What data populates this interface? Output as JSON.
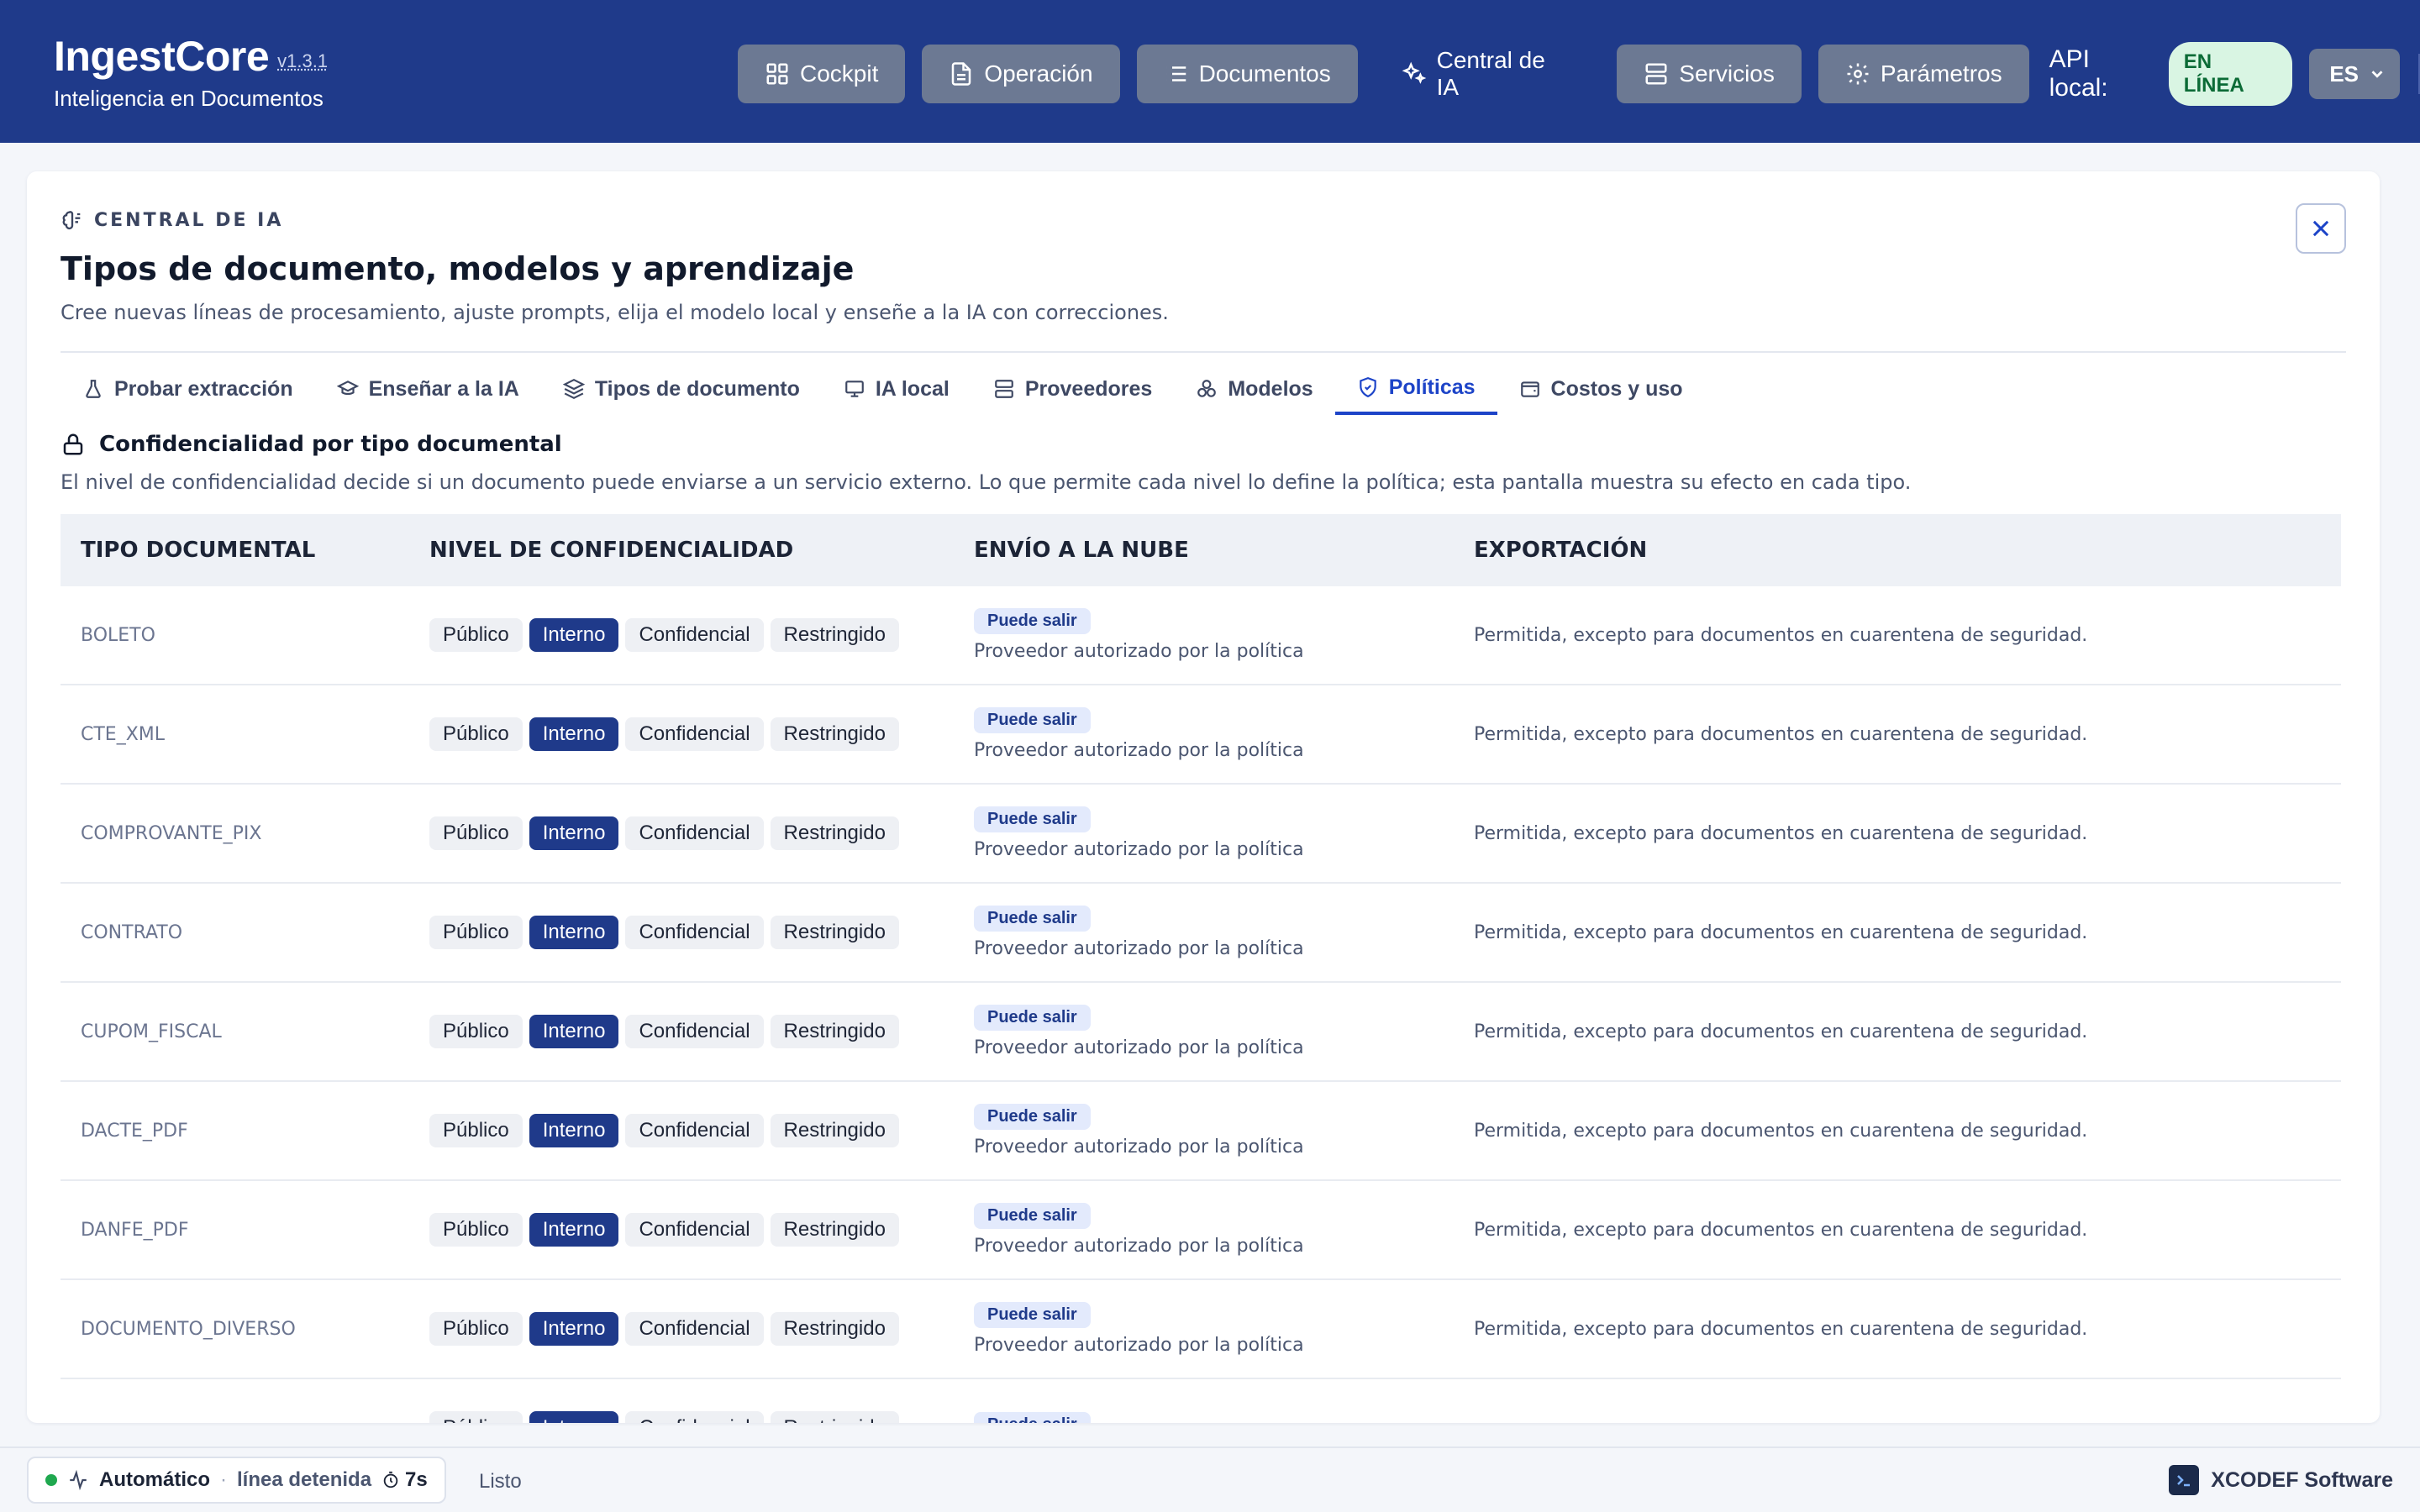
{
  "app": {
    "name": "IngestCore",
    "version": "v1.3.1",
    "subtitle": "Inteligencia en Documentos"
  },
  "nav": {
    "items": [
      {
        "label": "Cockpit",
        "icon": "grid-icon"
      },
      {
        "label": "Operación",
        "icon": "document-icon"
      },
      {
        "label": "Documentos",
        "icon": "list-icon"
      },
      {
        "label": "Central de IA",
        "icon": "sparkles-icon"
      },
      {
        "label": "Servicios",
        "icon": "server-icon"
      },
      {
        "label": "Parámetros",
        "icon": "gear-icon"
      }
    ],
    "api_label": "API local:",
    "api_status": "EN LÍNEA",
    "language": "ES"
  },
  "panel": {
    "eyebrow": "CENTRAL DE IA",
    "title": "Tipos de documento, modelos y aprendizaje",
    "subtitle": "Cree nuevas líneas de procesamiento, ajuste prompts, elija el modelo local y enseñe a la IA con correcciones."
  },
  "tabs": [
    {
      "label": "Probar extracción",
      "icon": "flask-icon"
    },
    {
      "label": "Enseñar a la IA",
      "icon": "graduation-cap-icon"
    },
    {
      "label": "Tipos de documento",
      "icon": "layers-icon"
    },
    {
      "label": "IA local",
      "icon": "monitor-icon"
    },
    {
      "label": "Proveedores",
      "icon": "server-icon"
    },
    {
      "label": "Modelos",
      "icon": "boxes-icon"
    },
    {
      "label": "Políticas",
      "icon": "shield-icon",
      "active": true
    },
    {
      "label": "Costos y uso",
      "icon": "wallet-icon"
    }
  ],
  "section": {
    "title": "Confidencialidad por tipo documental",
    "description": "El nivel de confidencialidad decide si un documento puede enviarse a un servicio externo. Lo que permite cada nivel lo define la política; esta pantalla muestra su efecto en cada tipo."
  },
  "table": {
    "headers": [
      "TIPO DOCUMENTAL",
      "NIVEL DE CONFIDENCIALIDAD",
      "ENVÍO A LA NUBE",
      "EXPORTACIÓN"
    ],
    "levels": [
      "Público",
      "Interno",
      "Confidencial",
      "Restringido"
    ],
    "rows": [
      {
        "type": "BOLETO",
        "level": "Interno",
        "cloud_badge": "Puede salir",
        "cloud_note": "Proveedor autorizado por la política",
        "export": "Permitida, excepto para documentos en cuarentena de seguridad."
      },
      {
        "type": "CTE_XML",
        "level": "Interno",
        "cloud_badge": "Puede salir",
        "cloud_note": "Proveedor autorizado por la política",
        "export": "Permitida, excepto para documentos en cuarentena de seguridad."
      },
      {
        "type": "COMPROVANTE_PIX",
        "level": "Interno",
        "cloud_badge": "Puede salir",
        "cloud_note": "Proveedor autorizado por la política",
        "export": "Permitida, excepto para documentos en cuarentena de seguridad."
      },
      {
        "type": "CONTRATO",
        "level": "Interno",
        "cloud_badge": "Puede salir",
        "cloud_note": "Proveedor autorizado por la política",
        "export": "Permitida, excepto para documentos en cuarentena de seguridad."
      },
      {
        "type": "CUPOM_FISCAL",
        "level": "Interno",
        "cloud_badge": "Puede salir",
        "cloud_note": "Proveedor autorizado por la política",
        "export": "Permitida, excepto para documentos en cuarentena de seguridad."
      },
      {
        "type": "DACTE_PDF",
        "level": "Interno",
        "cloud_badge": "Puede salir",
        "cloud_note": "Proveedor autorizado por la política",
        "export": "Permitida, excepto para documentos en cuarentena de seguridad."
      },
      {
        "type": "DANFE_PDF",
        "level": "Interno",
        "cloud_badge": "Puede salir",
        "cloud_note": "Proveedor autorizado por la política",
        "export": "Permitida, excepto para documentos en cuarentena de seguridad."
      },
      {
        "type": "DOCUMENTO_DIVERSO",
        "level": "Interno",
        "cloud_badge": "Puede salir",
        "cloud_note": "Proveedor autorizado por la política",
        "export": "Permitida, excepto para documentos en cuarentena de seguridad."
      },
      {
        "type": "",
        "level": "Interno",
        "cloud_badge": "Puede salir",
        "cloud_note": "",
        "export": ""
      }
    ]
  },
  "status": {
    "mode": "Automático",
    "separator": "·",
    "line_state": "línea detenida",
    "timer": "7s",
    "message": "Listo",
    "vendor": "XCODEF Software"
  },
  "colors": {
    "header": "#1f3a8a",
    "accent": "#1d44c8",
    "online_bg": "#d9f5e3",
    "online_text": "#0b6b36",
    "status_dot": "#1fa84f"
  }
}
